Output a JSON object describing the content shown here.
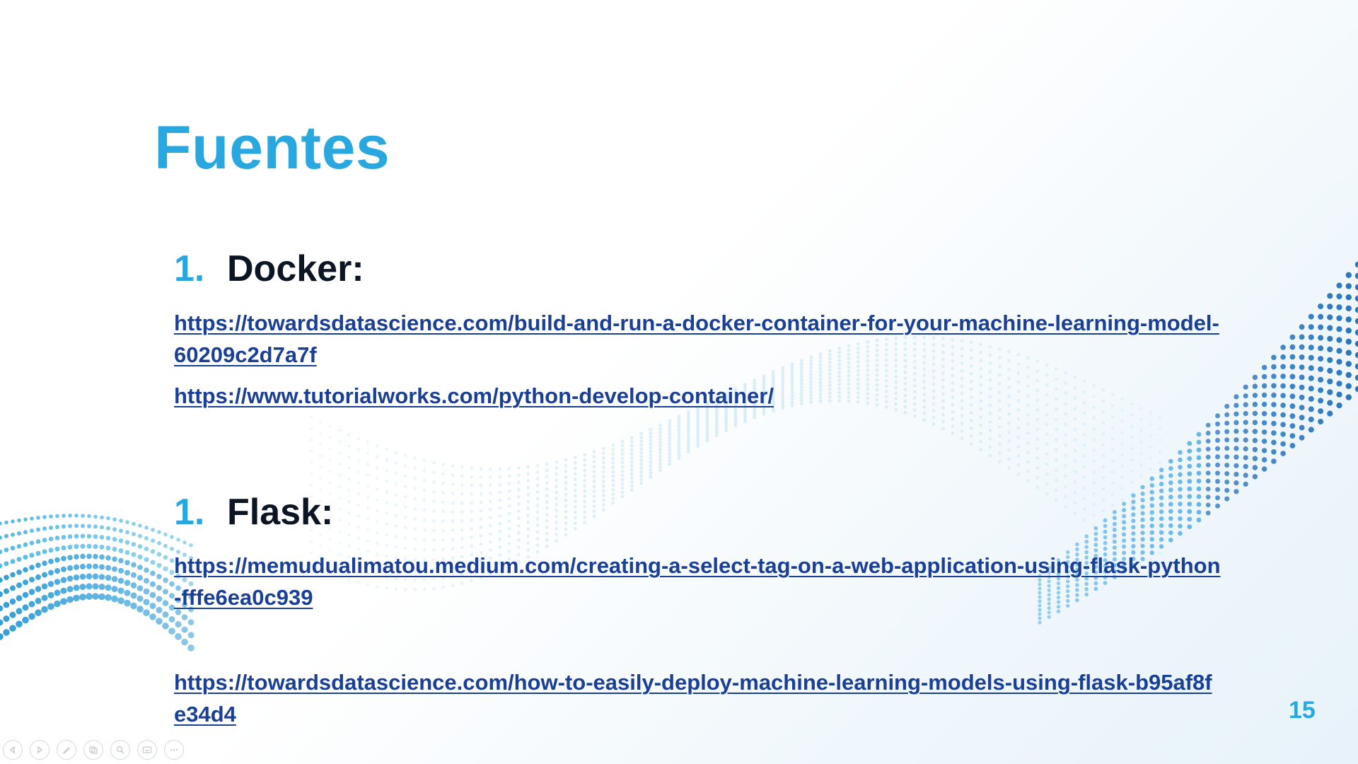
{
  "slide": {
    "title": "Fuentes",
    "page_number": "15",
    "sections": [
      {
        "number": "1.",
        "heading": "Docker:",
        "links": [
          "https://towardsdatascience.com/build-and-run-a-docker-container-for-your-machine-learning-model-60209c2d7a7f",
          "https://www.tutorialworks.com/python-develop-container/"
        ]
      },
      {
        "number": "1.",
        "heading": "Flask:",
        "links": [
          "https://memudualimatou.medium.com/creating-a-select-tag-on-a-web-application-using-flask-python-fffe6ea0c939",
          "https://towardsdatascience.com/how-to-easily-deploy-machine-learning-models-using-flask-b95af8fe34d4"
        ]
      }
    ]
  },
  "toolbar": {
    "icons": [
      "previous-icon",
      "next-icon",
      "pen-icon",
      "slides-icon",
      "zoom-icon",
      "subtitles-icon",
      "more-icon"
    ]
  },
  "colors": {
    "accent": "#29a8e0",
    "heading": "#0c1524",
    "link": "#1a3f96"
  }
}
